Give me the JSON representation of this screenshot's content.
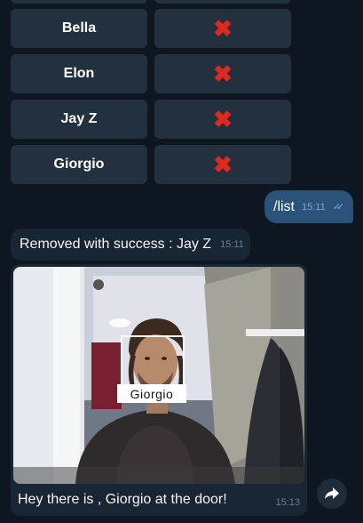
{
  "keyboard": {
    "rows": [
      {
        "name": "Bella",
        "remove_icon": "red-cross-icon"
      },
      {
        "name": "Elon",
        "remove_icon": "red-cross-icon"
      },
      {
        "name": "Jay Z",
        "remove_icon": "red-cross-icon"
      },
      {
        "name": "Giorgio",
        "remove_icon": "red-cross-icon"
      }
    ]
  },
  "outgoing": {
    "text": "/list",
    "time": "15:11",
    "status_icon": "double-check-icon"
  },
  "incoming": {
    "text": "Removed with success : Jay Z",
    "time": "15:11"
  },
  "photo_message": {
    "face_label": "Giorgio",
    "caption": "Hey there is  , Giorgio at the door!",
    "time": "15:13"
  },
  "share_icon": "forward-arrow-icon",
  "colors": {
    "background": "#0e1621",
    "button_bg": "#22313d",
    "cross": "#e0281f",
    "outgoing_bubble": "#2b5278",
    "incoming_bubble": "#182533"
  }
}
